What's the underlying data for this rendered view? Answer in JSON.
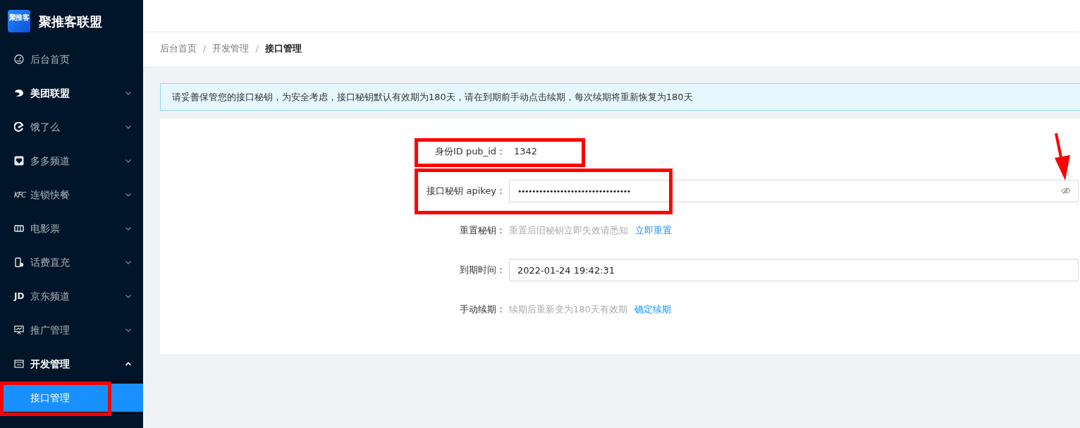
{
  "brand": {
    "logo_text": "聚推客",
    "name": "聚推客联盟"
  },
  "sidebar": {
    "items": [
      {
        "label": "后台首页",
        "kind": "gauge",
        "highlighted": false
      },
      {
        "label": "美团联盟",
        "kind": "swirl",
        "highlighted": true,
        "expanded": false
      },
      {
        "label": "饿了么",
        "kind": "e-letter",
        "highlighted": false,
        "expanded": false
      },
      {
        "label": "多多频道",
        "kind": "heart-badge",
        "highlighted": false,
        "expanded": false
      },
      {
        "label": "连锁快餐",
        "kind": "text",
        "icon_text": "KFC",
        "highlighted": false,
        "expanded": false
      },
      {
        "label": "电影票",
        "kind": "ticket",
        "highlighted": false,
        "expanded": false
      },
      {
        "label": "话费直充",
        "kind": "phone",
        "highlighted": false,
        "expanded": false
      },
      {
        "label": "京东频道",
        "kind": "text",
        "icon_text": "JD",
        "highlighted": false,
        "expanded": false
      },
      {
        "label": "推广管理",
        "kind": "chart-board",
        "highlighted": false,
        "expanded": false
      },
      {
        "label": "开发管理",
        "kind": "code-window",
        "highlighted": true,
        "expanded": true,
        "children": [
          {
            "label": "接口管理",
            "selected": true
          }
        ]
      }
    ]
  },
  "breadcrumb": {
    "separator": "/",
    "items": [
      {
        "label": "后台首页",
        "current": false
      },
      {
        "label": "开发管理",
        "current": false
      },
      {
        "label": "接口管理",
        "current": true
      }
    ]
  },
  "alert": "请妥善保管您的接口秘钥，为安全考虑，接口秘钥默认有效期为180天，请在到期前手动点击续期，每次续期将重新恢复为180天",
  "form": [
    {
      "kind": "text",
      "label": "身份ID pub_id：",
      "value": "1342"
    },
    {
      "kind": "secret",
      "label": "接口秘钥 apikey：",
      "value": "••••••••••••••••••••••••••••••••"
    },
    {
      "kind": "note",
      "label": "重置秘钥：",
      "note": "重置后旧秘钥立即失效请悉知",
      "link": "立即重置"
    },
    {
      "kind": "input",
      "label": "到期时间：",
      "value": "2022-01-24 19:42:31"
    },
    {
      "kind": "note",
      "label": "手动续期：",
      "note": "续期后重新变为180天有效期",
      "link": "确定续期"
    }
  ]
}
